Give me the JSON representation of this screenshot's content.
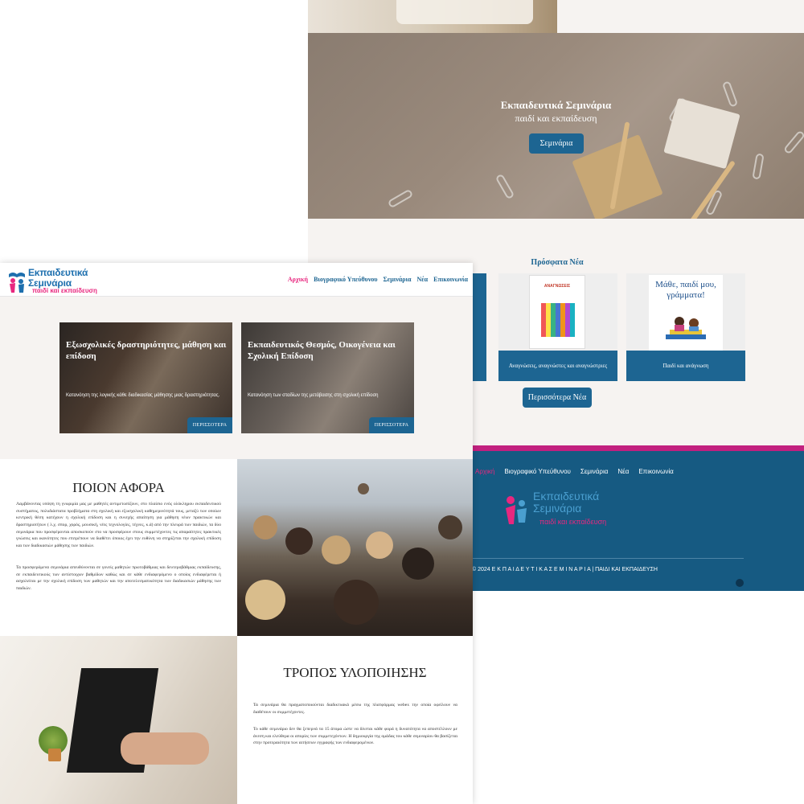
{
  "back": {
    "hero": {
      "title": "Εκπαιδευτικά Σεμινάρια",
      "subtitle": "παιδί και εκπαίδευση",
      "button": "Σεμινάρια"
    },
    "news": {
      "title": "Πρόσφατα Νέα",
      "cards": [
        {
          "caption": ""
        },
        {
          "caption": "Αναγνώσεις, αναγνώστες και αναγνώστριες",
          "book_title": "ΑΝΑΓΝΩΣΕΙΣ"
        },
        {
          "caption": "Παιδί και ανάγνωση",
          "book_title": "Μάθε, παιδί μου, γράμματα!"
        }
      ],
      "more_button": "Περισσότερα Νέα"
    },
    "footer": {
      "nav": [
        "Αρχική",
        "Βιογραφικό Υπεύθυνου",
        "Σεμινάρια",
        "Νέα",
        "Επικοινωνία"
      ],
      "logo_line1": "Εκπαιδευτικά",
      "logo_line2": "Σεμινάρια",
      "logo_line3": "παιδί και εκπαίδευση",
      "copyright": "© 2024 Ε Κ Π Α Ι Δ Ε Υ Τ Ι Κ Α Σ Ε Μ Ι Ν Α Ρ Ι Α | ΠΑΙΔΙ ΚΑΙ ΕΚΠΑΙΔΕΥΣΗ",
      "stripe_color": "#c2207f",
      "bg_color": "#165a82"
    }
  },
  "front": {
    "logo": {
      "line1": "Εκπαιδευτικά",
      "line2": "Σεμινάρια",
      "line3": "παιδί και εκπαίδευση"
    },
    "nav": [
      "Αρχική",
      "Βιογραφικό Υπεύθυνου",
      "Σεμινάρια",
      "Νέα",
      "Επικοινωνία"
    ],
    "cards": [
      {
        "title": "Εξωσχολικές δραστηριότητες, μάθηση και επίδοση",
        "description": "Κατανόηση της λογικής κάθε διαδικασίας μάθησης μιας δραστηριότητας.",
        "button": "ΠΕΡΙΣΣΟΤΕΡΑ"
      },
      {
        "title": "Εκπαιδευτικός Θεσμός, Οικογένεια και Σχολική Επίδοση",
        "description": "Κατανόηση των σταδίων της μετάβασης στη σχολική επίδοση",
        "button": "ΠΕΡΙΣΣΟΤΕΡΑ"
      }
    ],
    "who": {
      "title": "ΠΟΙΟΝ ΑΦΟΡΑ",
      "p1": "Λαμβάνοντας υπόψη τη γνωριμία μας με μαθητές αντιμετωπίζουν, στο πλαίσιο ενός ολόκληρου εκπαιδευτικού συστήματος, πολυδιάστατα προβλήματα στη σχολική και εξωσχολική καθημερινότητά τους, μεταξύ των οποίων κεντρική θέση κατέχουν η σχολική επίδοση και η συνεχής απαίτηση για μάθηση νέων πρακτικών και δραστηριοτήτων ( λ.χ. σπορ, χορός, μουσική, νέες τεχνολογίες, τέχνες, κ.ά) από την πλευρά των παιδιών, τα δύο σεμινάρια που προσφέρονται αποσκοπούν στο να προσφέρουν στους συμμετέχοντες τις απαραίτητες πρακτικές γνώσεις και ικανότητες που επιτρέπουν να διαθέτει όποιος έχει την ευθύνη να στηρίζεται την σχολική επίδοση και των διαδικασιών μάθησης των παιδιών.",
      "p2": "Τα προσφερόμενα σεμινάρια απευθύνονται σε γονείς μαθητών πρωτοβάθμιας και δευτεροβάθμιας εκπαίδευσης, σε εκπαιδευτικούς των αντίστοιχων βαθμίδων καθώς και σε κάθε ενδιαφερόμενο ο οποίος ενδιαφέρεται ή ασχολείται με την σχολική επίδοση των μαθητών και την αποτελεσματικότητα των διαδικασιών μάθησης των παιδιών."
    },
    "how": {
      "title": "ΤΡΟΠΟΣ ΥΛΟΠΟΙΗΣΗΣ",
      "p1": "Τα σεμινάρια θα πραγματοποιούνται διαδικτυακά μέσω της πλατφόρμας webex την οποία οφείλουν να διαθέτουν οι συμμετέχοντες.",
      "p2": "Το κάθε σεμινάριο δεν θα ξεπερνά τα 15 άτομα ώστε να δίνεται κάθε φορά η δυνατότητα να αποστέλλουν με άνεση και ελεύθερα οι απορίες των συμμετεχόντων. Η δημιουργία της ομάδας του κάθε σεμιναρίου θα βασίζεται στην προτεραιότητα των αιτήσεων εγγραφής των ενδιαφερομένων."
    },
    "accent_color": "#e8277f",
    "primary_color": "#1d6592"
  }
}
